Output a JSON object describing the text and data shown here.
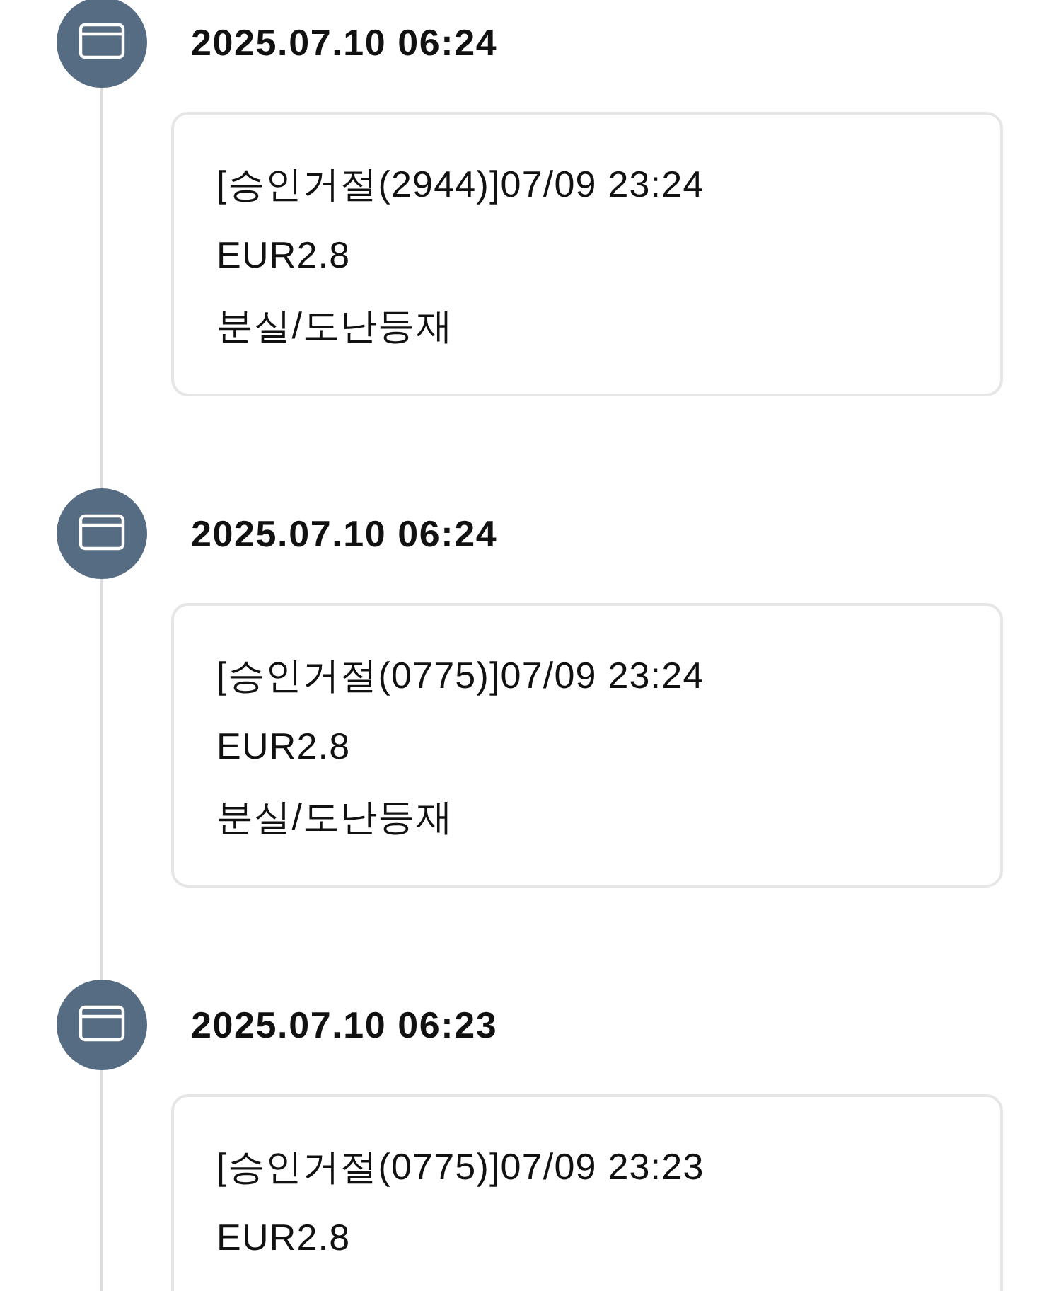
{
  "entries": [
    {
      "timestamp": "2025.07.10 06:24",
      "lines": [
        "[승인거절(2944)]07/09 23:24",
        "EUR2.8",
        "분실/도난등재"
      ]
    },
    {
      "timestamp": "2025.07.10 06:24",
      "lines": [
        "[승인거절(0775)]07/09 23:24",
        "EUR2.8",
        "분실/도난등재"
      ]
    },
    {
      "timestamp": "2025.07.10 06:23",
      "lines": [
        "[승인거절(0775)]07/09 23:23",
        "EUR2.8"
      ]
    }
  ]
}
